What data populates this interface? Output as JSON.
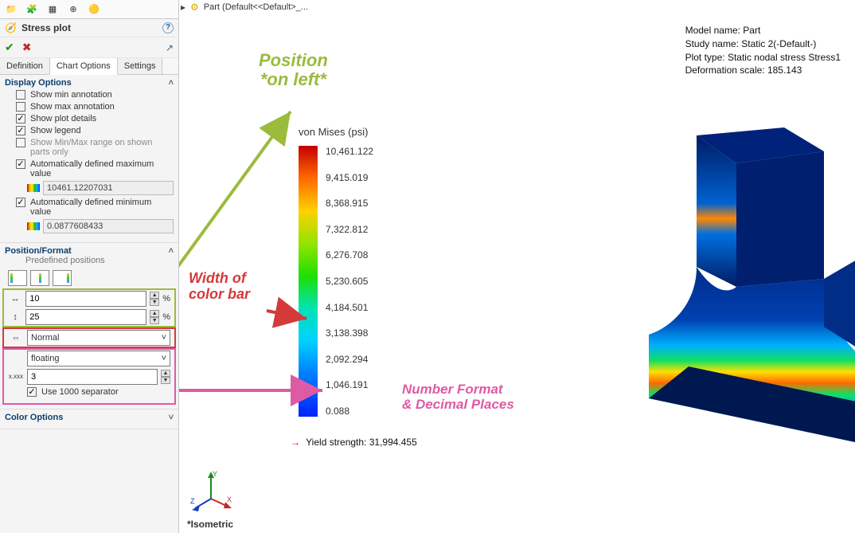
{
  "panel": {
    "title": "Stress plot",
    "tabs": {
      "definition": "Definition",
      "chart_options": "Chart Options",
      "settings": "Settings"
    }
  },
  "display": {
    "header": "Display Options",
    "show_min": "Show min annotation",
    "show_max": "Show max annotation",
    "show_plot_details": "Show plot details",
    "show_legend": "Show legend",
    "minmax_range": "Show Min/Max range on shown parts only",
    "auto_max": "Automatically defined maximum value",
    "max_value": "10461.12207031",
    "auto_min": "Automatically defined minimum value",
    "min_value": "0.0877608433"
  },
  "position_format": {
    "header": "Position/Format",
    "predef": "Predefined positions",
    "xval": "10",
    "yval": "25",
    "width_label": "Normal",
    "num_format": "floating",
    "decimals": "3",
    "use_1000_sep": "Use 1000 separator"
  },
  "color_options": {
    "header": "Color Options"
  },
  "breadcrumb": {
    "part": "Part (Default<<Default>_..."
  },
  "info": {
    "model": "Model name: Part",
    "study": "Study name: Static 2(-Default-)",
    "plottype": "Plot type: Static nodal stress Stress1",
    "deform": "Deformation scale: 185.143"
  },
  "annotations": {
    "position": "Position",
    "on_left": "*on left*",
    "width": "Width of",
    "color_bar": "color bar",
    "numf": "Number Format",
    "decp": "& Decimal Places"
  },
  "legend": {
    "title": "von Mises (psi)",
    "ticks": [
      "10,461.122",
      "9,415.019",
      "8,368.915",
      "7,322.812",
      "6,276.708",
      "5,230.605",
      "4,184.501",
      "3,138.398",
      "2,092.294",
      "1,046.191",
      "0.088"
    ]
  },
  "yield": {
    "label": "Yield strength: 31,994.455"
  },
  "view": {
    "iso": "*Isometric"
  }
}
